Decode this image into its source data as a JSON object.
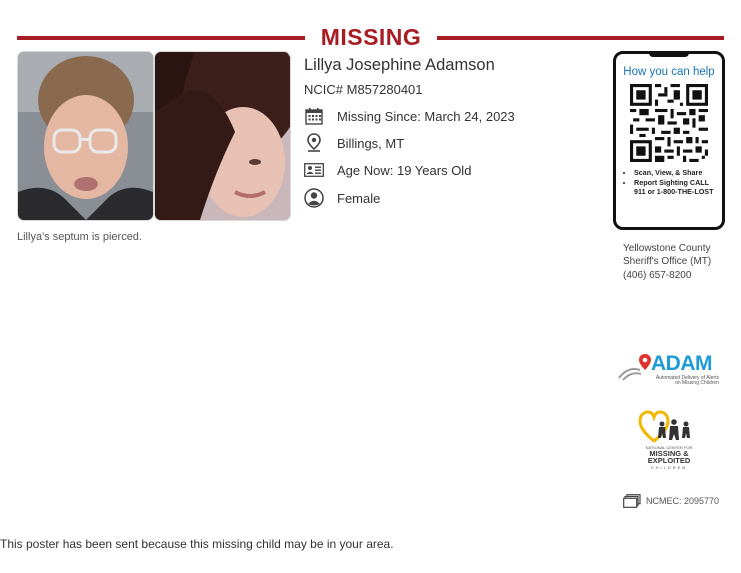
{
  "header": {
    "title": "MISSING"
  },
  "photos": {
    "caption": "Lillya's septum is pierced."
  },
  "person": {
    "name": "Lillya Josephine Adamson",
    "ncic": "NCIC# M857280401",
    "missing_since": "Missing Since: March 24, 2023",
    "location": "Billings, MT",
    "age": "Age Now: 19 Years Old",
    "sex": "Female"
  },
  "phone": {
    "heading": "How you can help",
    "bullets": [
      "Scan, View, & Share",
      "Report Sighting CALL 911 or 1-800-THE-LOST"
    ]
  },
  "agency": {
    "name_line1": "Yellowstone County",
    "name_line2": "Sheriff's Office (MT)",
    "phone": "(406) 657-8200"
  },
  "logos": {
    "adam_name": "ADAM",
    "adam_tag_line1": "Automated Delivery of Alerts",
    "adam_tag_line2": "on Missing Children",
    "ncmec_line1": "NATIONAL CENTER FOR",
    "ncmec_line2": "MISSING &",
    "ncmec_line3": "EXPLOITED",
    "ncmec_line4": "CHILDREN"
  },
  "case_number": "NCMEC: 2095770",
  "footer": {
    "note": "This poster has been sent because this missing child may be in your area."
  },
  "colors": {
    "accent": "#a61d24",
    "link": "#1a73b7",
    "adam_blue": "#1e9ad6",
    "adam_red": "#e0332f",
    "ncmec_heart": "#f2b800"
  },
  "icons": [
    "calendar-icon",
    "map-pin-icon",
    "id-card-icon",
    "person-icon",
    "documents-icon",
    "qr-code"
  ]
}
